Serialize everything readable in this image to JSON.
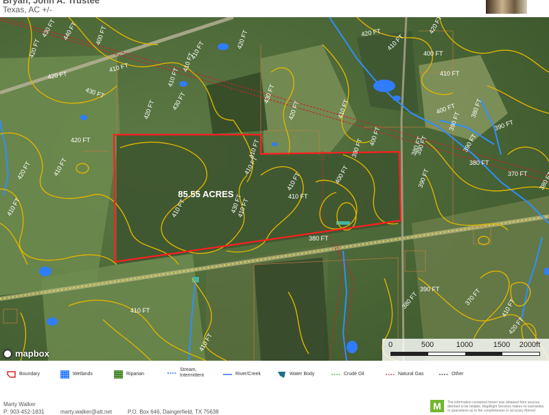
{
  "header": {
    "title": "Bryan, John A. Trustee",
    "subtitle": "Texas,  AC +/-"
  },
  "map": {
    "parcel_label": "85.55 ACRES",
    "attribution": "mapbox",
    "contour_labels": [
      "420 FT",
      "430 FT",
      "440 FT",
      "420 FT",
      "430 FT",
      "410 FT",
      "420 FT",
      "410 FT",
      "400 FT",
      "420 FT",
      "410 FT",
      "420 FT",
      "410 FT",
      "430 FT",
      "410 FT",
      "410 FT",
      "420 FT",
      "430 FT",
      "420 FT",
      "410 FT",
      "410 FT",
      "420 FT",
      "410 FT",
      "400 FT",
      "420 FT",
      "410 FT",
      "400 FT",
      "380 FT",
      "390 FT",
      "390 FT",
      "390 FT",
      "380 FT",
      "370 FT",
      "380 FT",
      "390 FT",
      "400 FT",
      "410 FT",
      "410 FT",
      "410 FT",
      "410 FT",
      "410 FT",
      "400 FT",
      "390 FT",
      "380 FT",
      "390 FT",
      "380 FT",
      "390 FT",
      "370 FT",
      "380 FT",
      "420 FT",
      "410 FT",
      "410 FT",
      "410 FT",
      "430 FT"
    ],
    "scale": {
      "ticks": [
        "0",
        "500",
        "1000",
        "1500",
        "2000ft"
      ]
    },
    "colors": {
      "boundary": "#ff1e1e",
      "contour": "#e0b400",
      "stream": "#2f8fff",
      "natural_gas": "#c0282c",
      "parcel_lines": "#c08040"
    }
  },
  "legend": {
    "items": [
      {
        "label": "Boundary",
        "icon": "boundary-icon"
      },
      {
        "label": "Wetlands",
        "icon": "wetlands-icon"
      },
      {
        "label": "Riparian",
        "icon": "riparian-icon"
      },
      {
        "label": "Stream,\nIntermittent",
        "icon": "stream-intermittent-icon"
      },
      {
        "label": "River/Creek",
        "icon": "river-creek-icon"
      },
      {
        "label": "Water Body",
        "icon": "water-body-icon"
      },
      {
        "label": "Crude Oil",
        "icon": "crude-oil-icon"
      },
      {
        "label": "Natural Gas",
        "icon": "natural-gas-icon"
      },
      {
        "label": "Other",
        "icon": "other-line-icon"
      }
    ]
  },
  "footer": {
    "agent": "Marty Walker",
    "phone": "P: 903-452-1831",
    "email": "marty.walker@att.net",
    "address": "P.O. Box 646, Daingerfield, TX 75638",
    "disclaimer": "The information contained herein was obtained from sources deemed to be reliable. MapRight Services makes no warranties or guarantees as to the completeness or accuracy thereof."
  }
}
